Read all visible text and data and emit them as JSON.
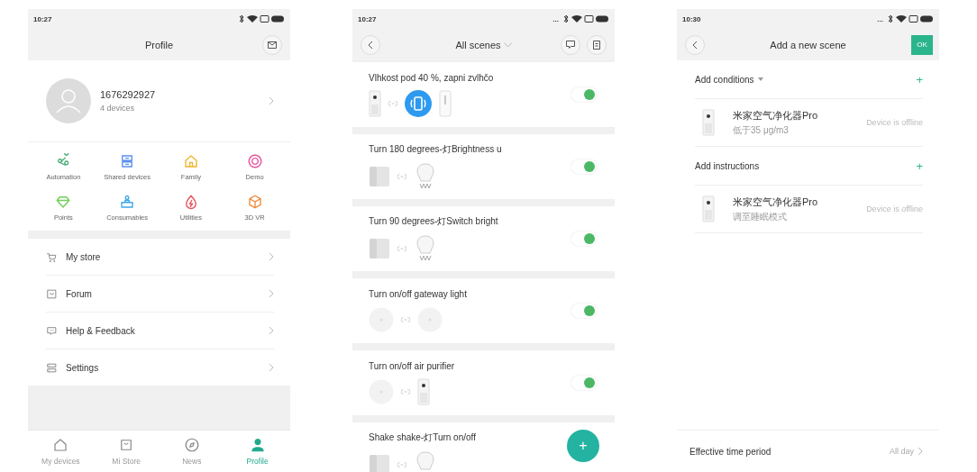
{
  "profile_screen": {
    "status_bar": {
      "time": "10:27"
    },
    "title": "Profile",
    "account": {
      "name": "1676292927",
      "subtitle": "4 devices"
    },
    "shortcuts": [
      "Automation",
      "Shared devices",
      "Family",
      "Demo",
      "Points",
      "Consumables",
      "Utilities",
      "3D VR"
    ],
    "menu": [
      "My store",
      "Forum",
      "Help & Feedback",
      "Settings"
    ],
    "tabs": [
      {
        "label": "My devices",
        "selected": false
      },
      {
        "label": "Mi Store",
        "selected": false
      },
      {
        "label": "News",
        "selected": false
      },
      {
        "label": "Profile",
        "selected": true
      }
    ]
  },
  "scenes_screen": {
    "status_bar": {
      "time": "10:27",
      "overflow": "..."
    },
    "title": "All scenes",
    "scenes": [
      {
        "name": "Vlhkost pod 40 %, zapni zvlhčo",
        "on": true,
        "devices": [
          {
            "kind": "purifier"
          },
          {
            "kind": "phone"
          },
          {
            "kind": "humidifier"
          }
        ]
      },
      {
        "name": "Turn 180 degrees-灯Brightness u",
        "on": true,
        "devices": [
          {
            "kind": "cube"
          },
          {
            "kind": "bulb"
          }
        ]
      },
      {
        "name": "Turn 90 degrees-灯Switch bright",
        "on": true,
        "devices": [
          {
            "kind": "cube"
          },
          {
            "kind": "bulb"
          }
        ]
      },
      {
        "name": "Turn on/off gateway light",
        "on": true,
        "devices": [
          {
            "kind": "button"
          },
          {
            "kind": "button"
          }
        ]
      },
      {
        "name": "Turn on/off air purifier",
        "on": true,
        "devices": [
          {
            "kind": "button"
          },
          {
            "kind": "purifier"
          }
        ]
      },
      {
        "name": "Shake shake-灯Turn on/off",
        "devices": [
          {
            "kind": "cube"
          },
          {
            "kind": "bulb"
          }
        ]
      }
    ],
    "fab": "+"
  },
  "new_scene_screen": {
    "status_bar": {
      "time": "10:30",
      "overflow": "..."
    },
    "title": "Add a new scene",
    "ok": "OK",
    "sections": [
      {
        "title": "Add conditions",
        "dropdown": true,
        "add": "+",
        "devices": [
          {
            "kind": "purifier",
            "name": "米家空气净化器Pro",
            "detail": "低于35 μg/m3",
            "status": "Device is offline"
          }
        ]
      },
      {
        "title": "Add instructions",
        "dropdown": false,
        "add": "+",
        "devices": [
          {
            "kind": "purifier",
            "name": "米家空气净化器Pro",
            "detail": "调至睡眠模式",
            "status": "Device is offline"
          }
        ]
      }
    ],
    "time_period": {
      "label": "Effective time period",
      "value": "All day"
    }
  }
}
